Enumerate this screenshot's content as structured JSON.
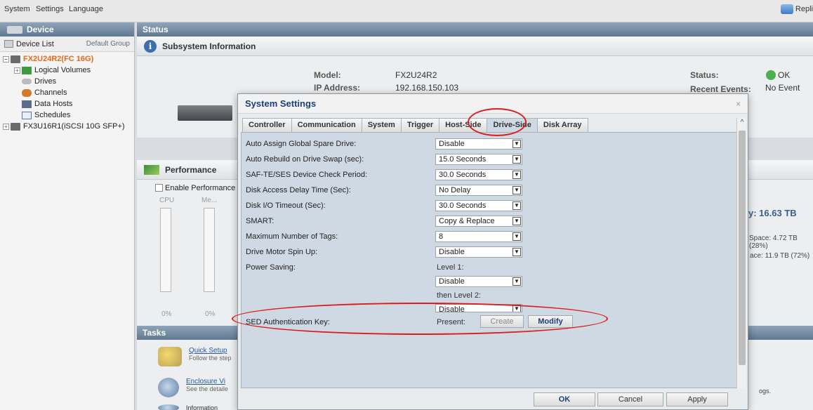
{
  "menubar": {
    "items": [
      "System",
      "Settings",
      "Language"
    ],
    "replicate_label": "Repli"
  },
  "device_panel": {
    "title": "Device",
    "device_list_label": "Device List",
    "group_label": "Default Group",
    "tree": {
      "selected": "FX2U24R2(FC 16G)",
      "children": [
        "Logical Volumes",
        "Drives",
        "Channels",
        "Data Hosts",
        "Schedules"
      ],
      "other": "FX3U16R1(iSCSI 10G SFP+)"
    }
  },
  "status": {
    "title": "Status",
    "subsystem_title": "Subsystem Information",
    "model_label": "Model:",
    "model_value": "FX2U24R2",
    "ip_label": "IP Address:",
    "ip_value": "192.168.150.103",
    "status_label": "Status:",
    "status_value": "OK",
    "events_label": "Recent Events:",
    "events_value": "No Event"
  },
  "performance": {
    "title": "Performance",
    "enable_label": "Enable Performance Mo",
    "cpu_label": "CPU",
    "mem_label": "Me...",
    "cpu_pct": "0%",
    "mem_pct": "0%",
    "capacity_text": "y: 16.63 TB",
    "space_used": "Space: 4.72 TB (28%)",
    "space_free": "ace: 11.9 TB (72%)"
  },
  "tasks": {
    "title": "Tasks",
    "items": [
      {
        "link": "Quick Setup",
        "desc": "Follow the step"
      },
      {
        "link": "Enclosure Vi",
        "desc": "See the detaile"
      },
      {
        "link": "Information",
        "desc": ""
      }
    ],
    "right_fragment": "ogs."
  },
  "dialog": {
    "title": "System Settings",
    "close": "×",
    "tabs": [
      "Controller",
      "Communication",
      "System",
      "Trigger",
      "Host-Side",
      "Drive-Side",
      "Disk Array"
    ],
    "active_tab": "Drive-Side",
    "rows": [
      {
        "label": "Auto Assign Global Spare Drive:",
        "value": "Disable"
      },
      {
        "label": "Auto Rebuild on Drive Swap (sec):",
        "value": "15.0 Seconds"
      },
      {
        "label": "SAF-TE/SES Device Check Period:",
        "value": "30.0 Seconds"
      },
      {
        "label": "Disk Access Delay Time (Sec):",
        "value": "No Delay"
      },
      {
        "label": "Disk I/O Timeout (Sec):",
        "value": "30.0 Seconds"
      },
      {
        "label": "SMART:",
        "value": "Copy & Replace"
      },
      {
        "label": "Maximum Number of Tags:",
        "value": "8"
      },
      {
        "label": "Drive Motor Spin Up:",
        "value": "Disable"
      }
    ],
    "power_saving": {
      "label": "Power Saving:",
      "level1_label": "Level 1:",
      "level1_value": "Disable",
      "level2_label": "then Level 2:",
      "level2_value": "Disable"
    },
    "sed": {
      "label": "SED Authentication Key:",
      "present_label": "Present:",
      "create": "Create",
      "modify": "Modify"
    },
    "footer": {
      "ok": "OK",
      "cancel": "Cancel",
      "apply": "Apply"
    }
  }
}
